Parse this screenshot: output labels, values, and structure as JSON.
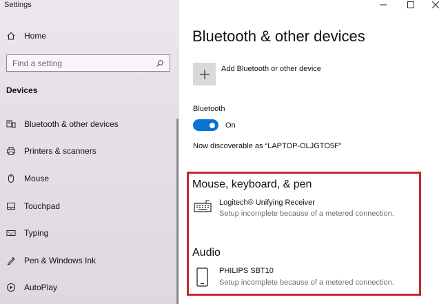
{
  "window": {
    "title": "Settings"
  },
  "sidebar": {
    "home_label": "Home",
    "search_placeholder": "Find a setting",
    "section_title": "Devices",
    "items": [
      {
        "label": "Bluetooth & other devices",
        "icon": "bluetooth-devices-icon"
      },
      {
        "label": "Printers & scanners",
        "icon": "printer-icon"
      },
      {
        "label": "Mouse",
        "icon": "mouse-icon"
      },
      {
        "label": "Touchpad",
        "icon": "touchpad-icon"
      },
      {
        "label": "Typing",
        "icon": "keyboard-icon"
      },
      {
        "label": "Pen & Windows Ink",
        "icon": "pen-icon"
      },
      {
        "label": "AutoPlay",
        "icon": "autoplay-icon"
      }
    ]
  },
  "main": {
    "title": "Bluetooth & other devices",
    "add_device_label": "Add Bluetooth or other device",
    "bluetooth_label": "Bluetooth",
    "toggle_state": "On",
    "discoverable_text": "Now discoverable as “LAPTOP-OLJGTO5F”",
    "groups": [
      {
        "title": "Mouse, keyboard, & pen",
        "devices": [
          {
            "name": "Logitech® Unifying Receiver",
            "status": "Setup incomplete because of a metered connection.",
            "icon": "keyboard-icon"
          }
        ]
      },
      {
        "title": "Audio",
        "devices": [
          {
            "name": "PHILIPS SBT10",
            "status": "Setup incomplete because of a metered connection.",
            "icon": "phone-icon"
          }
        ]
      }
    ]
  },
  "colors": {
    "accent": "#0a74d6",
    "highlight_border": "#c1272d"
  }
}
